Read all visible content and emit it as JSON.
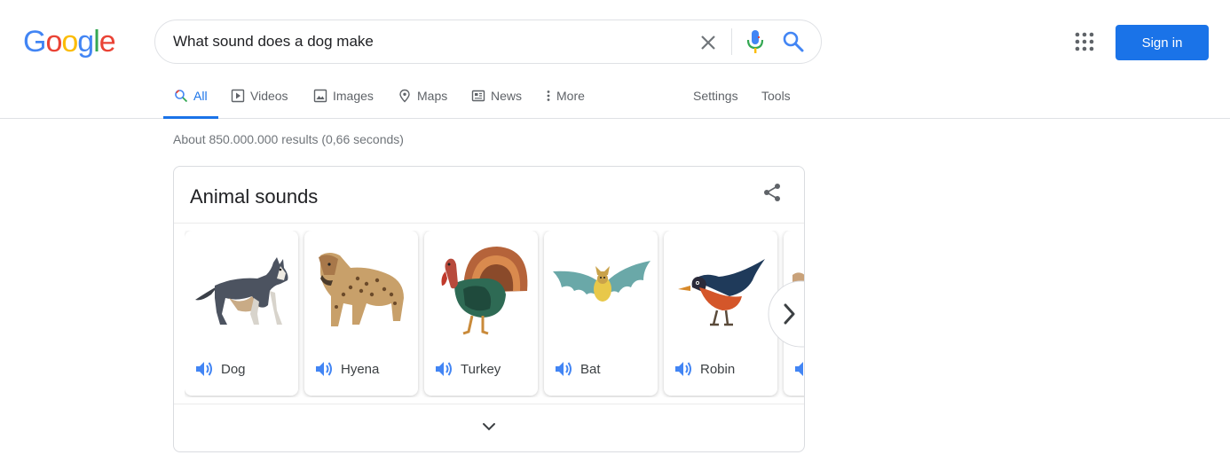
{
  "logo": {
    "letters": [
      "G",
      "o",
      "o",
      "g",
      "l",
      "e"
    ],
    "colors": [
      "#4285f4",
      "#ea4335",
      "#fbbc05",
      "#4285f4",
      "#34a853",
      "#ea4335"
    ]
  },
  "search": {
    "query": "What sound does a dog make"
  },
  "header": {
    "signin_label": "Sign in"
  },
  "tabs": [
    {
      "label": "All",
      "icon": "search-icon",
      "active": true
    },
    {
      "label": "Videos",
      "icon": "video-icon"
    },
    {
      "label": "Images",
      "icon": "image-icon"
    },
    {
      "label": "Maps",
      "icon": "map-pin-icon"
    },
    {
      "label": "News",
      "icon": "news-icon"
    },
    {
      "label": "More",
      "icon": "more-vert-icon"
    },
    {
      "label": "Settings"
    },
    {
      "label": "Tools"
    }
  ],
  "results": {
    "stats": "About 850.000.000 results (0,66 seconds)"
  },
  "card": {
    "title": "Animal sounds",
    "animals": [
      {
        "label": "Dog",
        "icon": "dog-image"
      },
      {
        "label": "Hyena",
        "icon": "hyena-image"
      },
      {
        "label": "Turkey",
        "icon": "turkey-image"
      },
      {
        "label": "Bat",
        "icon": "bat-image"
      },
      {
        "label": "Robin",
        "icon": "robin-image"
      },
      {
        "label": "",
        "icon": "partial-animal-image"
      }
    ]
  },
  "colors": {
    "accent": "#1a73e8",
    "sound_icon": "#4285f4"
  }
}
